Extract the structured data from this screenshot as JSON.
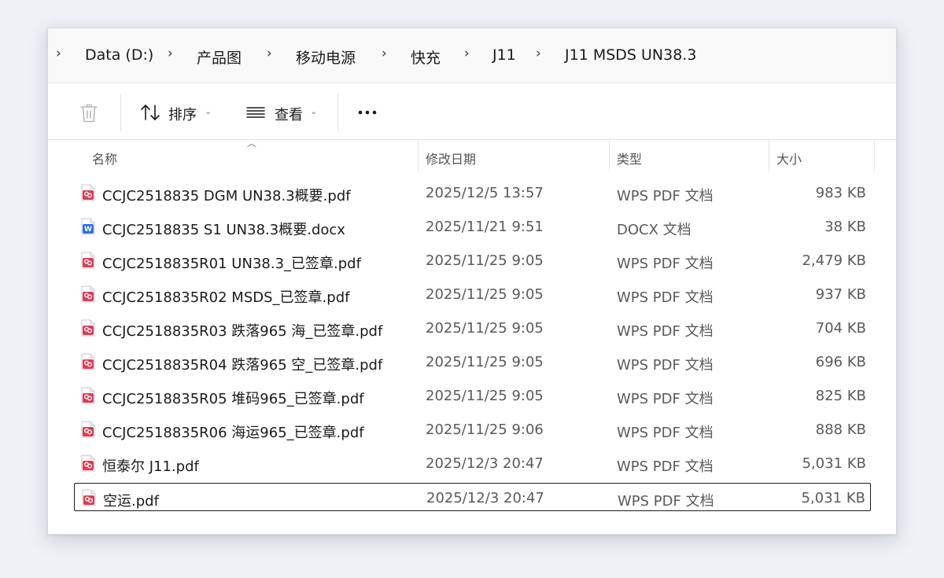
{
  "breadcrumb": {
    "items": [
      "Data (D:)",
      "产品图",
      "移动电源",
      "快充",
      "J11",
      "J11 MSDS UN38.3"
    ],
    "separator": "›"
  },
  "toolbar": {
    "sort_label": "排序",
    "view_label": "查看",
    "more_label": "•••"
  },
  "columns": {
    "name": "名称",
    "date": "修改日期",
    "type": "类型",
    "size": "大小"
  },
  "files": [
    {
      "name": "CCJC2518835 DGM UN38.3概要.pdf",
      "date": "2025/12/5 13:57",
      "type": "WPS PDF 文档",
      "size": "983 KB",
      "icon": "pdf-icon"
    },
    {
      "name": "CCJC2518835 S1 UN38.3概要.docx",
      "date": "2025/11/21 9:51",
      "type": "DOCX 文档",
      "size": "38 KB",
      "icon": "word-icon"
    },
    {
      "name": "CCJC2518835R01 UN38.3_已签章.pdf",
      "date": "2025/11/25 9:05",
      "type": "WPS PDF 文档",
      "size": "2,479 KB",
      "icon": "pdf-icon"
    },
    {
      "name": "CCJC2518835R02 MSDS_已签章.pdf",
      "date": "2025/11/25 9:05",
      "type": "WPS PDF 文档",
      "size": "937 KB",
      "icon": "pdf-icon"
    },
    {
      "name": "CCJC2518835R03 跌落965 海_已签章.pdf",
      "date": "2025/11/25 9:05",
      "type": "WPS PDF 文档",
      "size": "704 KB",
      "icon": "pdf-icon"
    },
    {
      "name": "CCJC2518835R04 跌落965 空_已签章.pdf",
      "date": "2025/11/25 9:05",
      "type": "WPS PDF 文档",
      "size": "696 KB",
      "icon": "pdf-icon"
    },
    {
      "name": "CCJC2518835R05 堆码965_已签章.pdf",
      "date": "2025/11/25 9:05",
      "type": "WPS PDF 文档",
      "size": "825 KB",
      "icon": "pdf-icon"
    },
    {
      "name": "CCJC2518835R06 海运965_已签章.pdf",
      "date": "2025/11/25 9:06",
      "type": "WPS PDF 文档",
      "size": "888 KB",
      "icon": "pdf-icon"
    },
    {
      "name": "恒泰尔 J11.pdf",
      "date": "2025/12/3 20:47",
      "type": "WPS PDF 文档",
      "size": "5,031 KB",
      "icon": "pdf-icon"
    },
    {
      "name": "空运.pdf",
      "date": "2025/12/3 20:47",
      "type": "WPS PDF 文档",
      "size": "5,031 KB",
      "icon": "pdf-icon",
      "selected": true
    }
  ],
  "colors": {
    "pdf_icon": "#e03a55",
    "word_icon": "#2e6fd8",
    "accent": "#0067c0"
  }
}
